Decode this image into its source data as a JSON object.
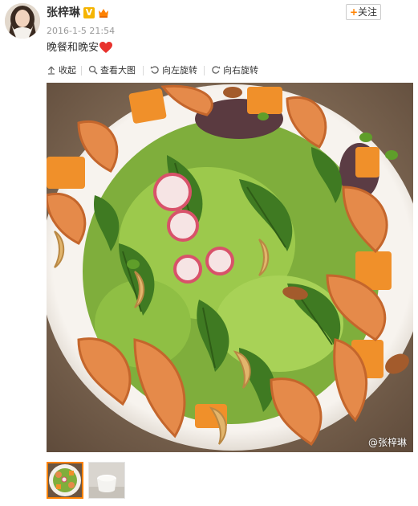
{
  "user": {
    "name": "张梓琳",
    "verified_badge": "V",
    "vip_badge": "vip-crown-icon"
  },
  "post": {
    "timestamp": "2016-1-5 21:54",
    "text": "晚餐和晚安",
    "emoji": "red-heart-icon"
  },
  "follow": {
    "plus": "+",
    "label": "关注"
  },
  "toolbar": [
    {
      "icon": "collapse-up-icon",
      "label": "收起"
    },
    {
      "icon": "magnify-icon",
      "label": "查看大图"
    },
    {
      "icon": "rotate-left-icon",
      "label": "向左旋转"
    },
    {
      "icon": "rotate-right-icon",
      "label": "向右旋转"
    }
  ],
  "photo": {
    "watermark": "@张梓琳",
    "subject": "shrimp-salad-photo"
  },
  "thumbnails": [
    {
      "name": "thumbnail-salad",
      "selected": true
    },
    {
      "name": "thumbnail-milk",
      "selected": false
    }
  ],
  "colors": {
    "accent": "#ff8200",
    "verified": "#f5b400",
    "muted_text": "#999999"
  }
}
